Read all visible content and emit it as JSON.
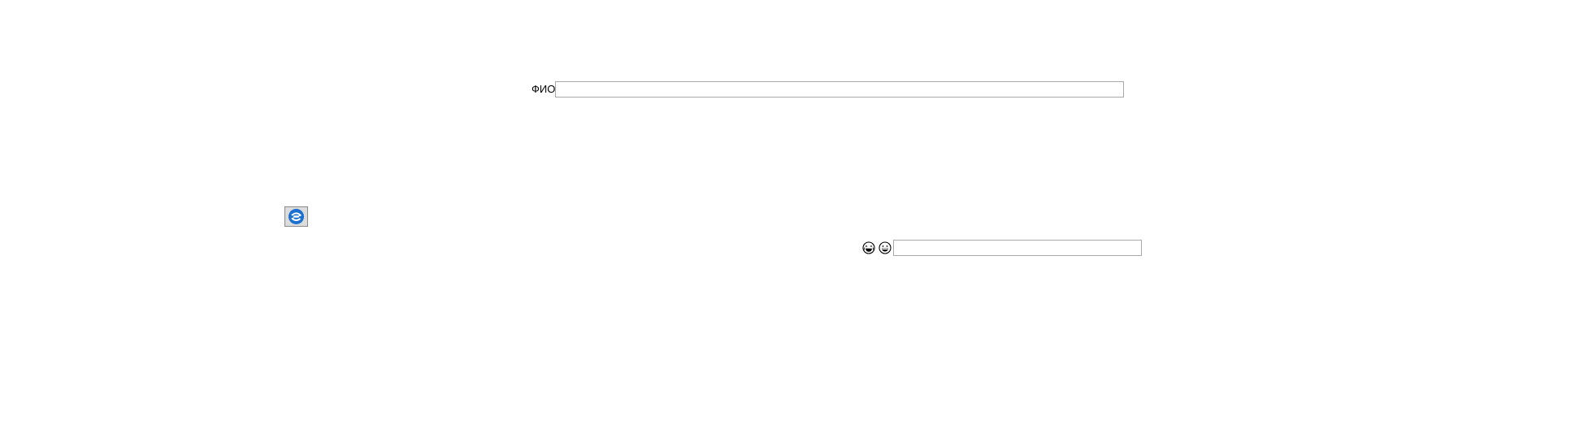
{
  "form": {
    "fio_label": "ФИО",
    "fio_value": "",
    "captcha_value": ""
  },
  "icons": {
    "refresh_button": "refresh-icon",
    "emoji_1": "laughing-face-icon",
    "emoji_2": "grinning-face-icon"
  },
  "colors": {
    "refresh_blue": "#1a6fd1",
    "input_border": "#a9a9a9"
  }
}
